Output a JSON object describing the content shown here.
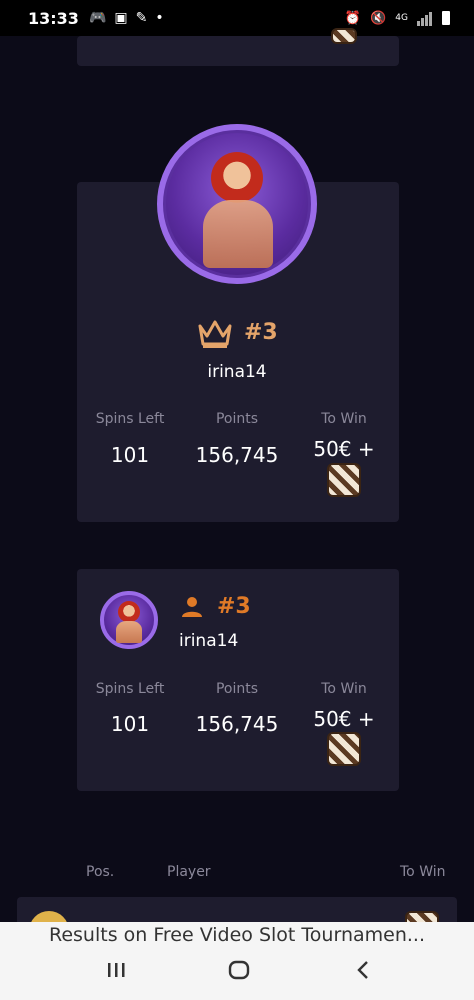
{
  "status_bar": {
    "time": "13:33",
    "network": "4G",
    "icons": [
      "gamepad-icon",
      "photo-icon",
      "broom-icon",
      "dot-icon",
      "alarm-icon",
      "mute-icon",
      "signal-icon",
      "battery-icon"
    ]
  },
  "featured": {
    "rank": "#3",
    "player": "irina14",
    "stats": {
      "spins_label": "Spins Left",
      "spins": "101",
      "points_label": "Points",
      "points": "156,745",
      "win_label": "To Win",
      "win": "50€ +"
    }
  },
  "my_entry": {
    "rank": "#3",
    "player": "irina14",
    "stats": {
      "spins_label": "Spins Left",
      "spins": "101",
      "points_label": "Points",
      "points": "156,745",
      "win_label": "To Win",
      "win": "50€ +"
    }
  },
  "table_header": {
    "pos": "Pos.",
    "player": "Player",
    "to_win": "To Win"
  },
  "banner": {
    "text": "Results on Free Video Slot Tournamen..."
  },
  "colors": {
    "accent": "#e07a27",
    "card": "#1e1c2e",
    "background": "#0c0b18"
  }
}
